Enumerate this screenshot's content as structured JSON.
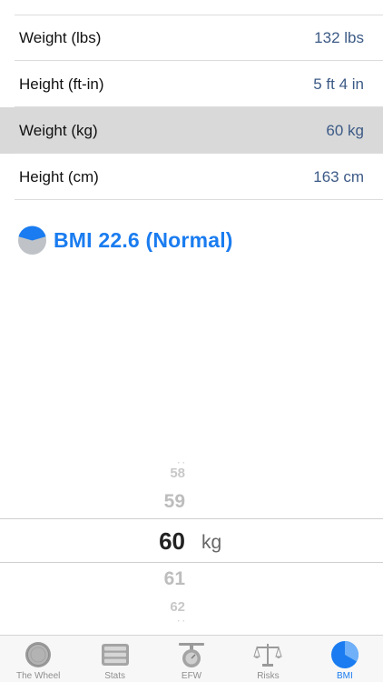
{
  "rows": [
    {
      "label": "Weight (lbs)",
      "value": "132 lbs"
    },
    {
      "label": "Height (ft-in)",
      "value": "5 ft 4 in"
    },
    {
      "label": "Weight (kg)",
      "value": "60 kg"
    },
    {
      "label": "Height (cm)",
      "value": "163 cm"
    }
  ],
  "bmi": {
    "text": "BMI 22.6 (Normal)"
  },
  "picker": {
    "values": [
      "58",
      "59",
      "60",
      "61",
      "62"
    ],
    "selected": "60",
    "unit": "kg"
  },
  "tabs": [
    {
      "label": "The Wheel",
      "icon": "wheel-icon"
    },
    {
      "label": "Stats",
      "icon": "stats-icon"
    },
    {
      "label": "EFW",
      "icon": "scale-icon"
    },
    {
      "label": "Risks",
      "icon": "balance-icon"
    },
    {
      "label": "BMI",
      "icon": "bmi-pie-icon"
    }
  ],
  "colors": {
    "accent": "#1a7cf0",
    "value": "#3c5a86",
    "selected_row": "#d9d9d9"
  }
}
